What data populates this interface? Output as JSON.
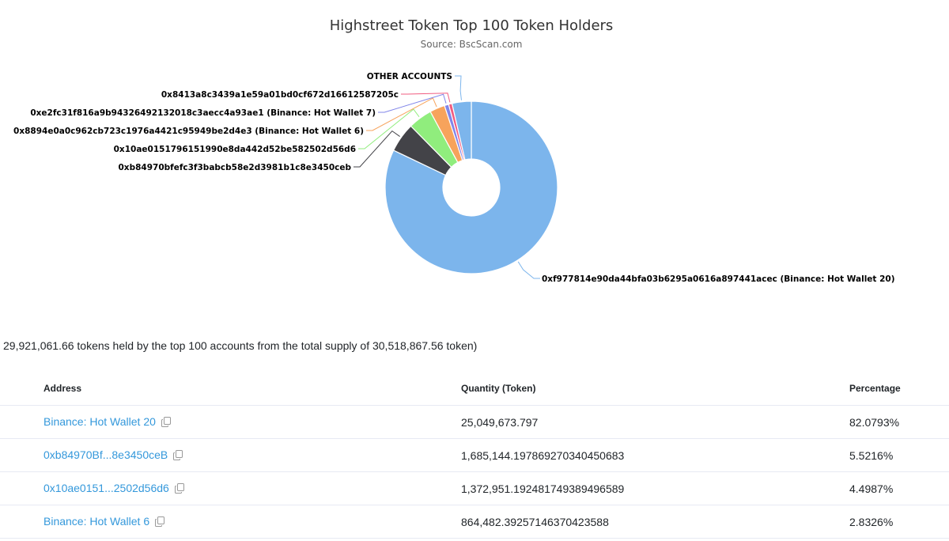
{
  "chart_data": {
    "type": "pie",
    "title": "Highstreet Token Top 100 Token Holders",
    "subtitle": "Source: BscScan.com",
    "slices": [
      {
        "label": "0xf977814e90da44bfa03b6295a0616a897441acec (Binance: Hot Wallet 20)",
        "value": 82.0793,
        "color": "#7cb5ec"
      },
      {
        "label": "0xb84970bfefc3f3babcb58e2d3981b1c8e3450ceb",
        "value": 5.5216,
        "color": "#434348"
      },
      {
        "label": "0x10ae0151796151990e8da442d52be582502d56d6",
        "value": 4.4987,
        "color": "#90ed7d"
      },
      {
        "label": "0x8894e0a0c962cb723c1976a4421c95949be2d4e3 (Binance: Hot Wallet 6)",
        "value": 2.8326,
        "color": "#f7a35c"
      },
      {
        "label": "0xe2fc31f816a9b94326492132018c3aecc4a93ae1 (Binance: Hot Wallet 7)",
        "value": 0.8,
        "color": "#8085e9"
      },
      {
        "label": "0x8413a8c3439a1e59a01bd0cf672d16612587205c",
        "value": 0.65,
        "color": "#f15c80"
      },
      {
        "label": "OTHER ACCOUNTS",
        "value": 3.6,
        "color": "#7cb5ec"
      }
    ]
  },
  "summary": {
    "text": "29,921,061.66 tokens held by the top 100 accounts from the total supply of 30,518,867.56 token)"
  },
  "table": {
    "headers": {
      "address": "Address",
      "quantity": "Quantity (Token)",
      "percentage": "Percentage"
    },
    "rows": [
      {
        "address": "Binance: Hot Wallet 20",
        "quantity": "25,049,673.797",
        "percentage": "82.0793%"
      },
      {
        "address": "0xb84970Bf...8e3450ceB",
        "quantity": "1,685,144.197869270340450683",
        "percentage": "5.5216%"
      },
      {
        "address": "0x10ae0151...2502d56d6",
        "quantity": "1,372,951.192481749389496589",
        "percentage": "4.4987%"
      },
      {
        "address": "Binance: Hot Wallet 6",
        "quantity": "864,482.39257146370423588",
        "percentage": "2.8326%"
      }
    ]
  },
  "icons": {
    "copy": "copy-icon"
  },
  "colors": {
    "link": "#3498db",
    "border": "#e7eaf3"
  }
}
